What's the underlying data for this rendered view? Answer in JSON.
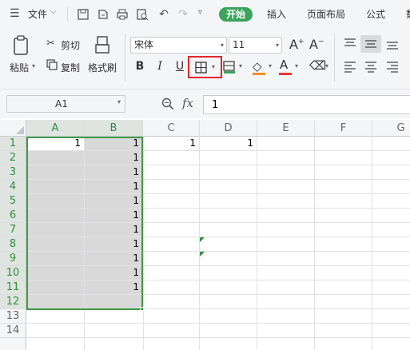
{
  "menu": {
    "file_label": "文件",
    "tabs": [
      "开始",
      "插入",
      "页面布局",
      "公式",
      "数"
    ]
  },
  "ribbon": {
    "paste_label": "粘贴",
    "cut_label": "剪切",
    "copy_label": "复制",
    "format_painter_label": "格式刷",
    "font_name": "宋体",
    "font_size": "11"
  },
  "formula_bar": {
    "name_box": "A1",
    "fx_label": "fx",
    "value": "1"
  },
  "sheet": {
    "columns": [
      "A",
      "B",
      "C",
      "D",
      "E",
      "F",
      "G"
    ],
    "rows": [
      "1",
      "2",
      "3",
      "4",
      "5",
      "6",
      "7",
      "8",
      "9",
      "10",
      "11",
      "12",
      "13",
      "14"
    ],
    "row1": {
      "A": "1",
      "B": "1",
      "C": "1",
      "D": "1"
    },
    "colB": [
      "1",
      "1",
      "1",
      "1",
      "1",
      "1",
      "1",
      "1",
      "1",
      "1",
      "1"
    ],
    "selection": "A1:B12"
  },
  "colors": {
    "accent": "#3aa35c",
    "selection_border": "#3e9a47",
    "highlight_box": "#e0262b"
  }
}
